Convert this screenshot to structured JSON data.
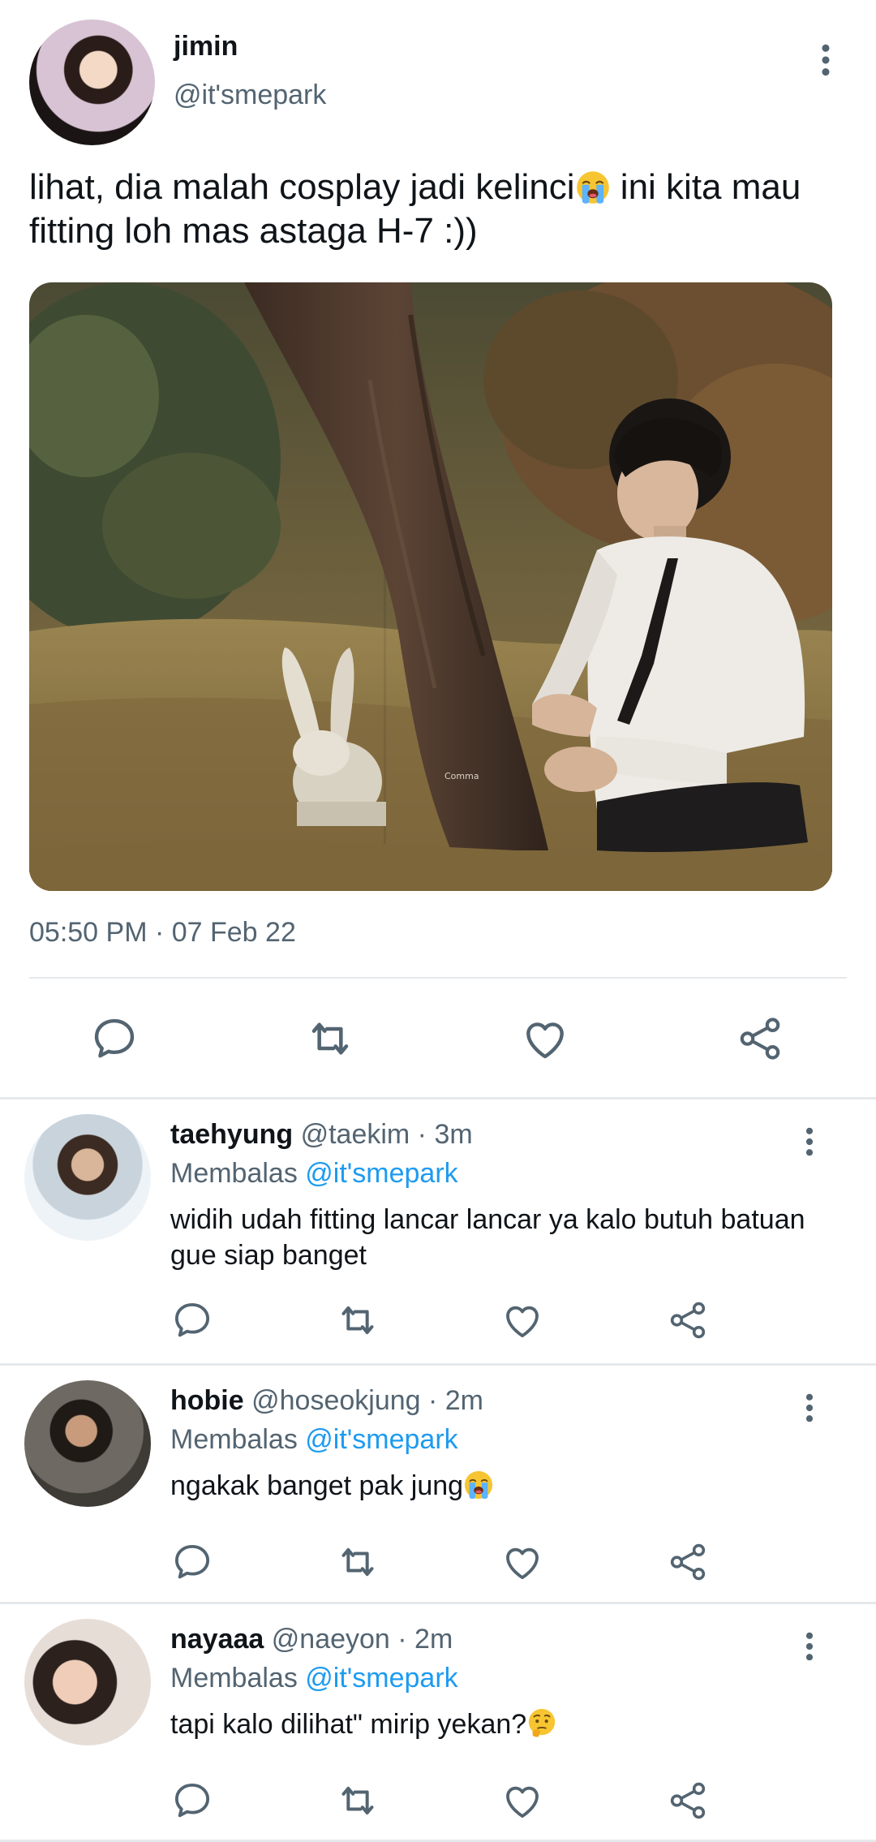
{
  "main_tweet": {
    "author_name": "jimin",
    "author_handle": "@it'smepark",
    "text": "lihat, dia malah cosplay jadi kelinci",
    "text_after_emoji": " ini kita mau fitting loh mas astaga H-7 :))",
    "text_emoji": "loudly-crying-face",
    "image_watermark": "Comma",
    "timestamp": "05:50 PM · 07 Feb 22",
    "actions": [
      "reply",
      "retweet",
      "like",
      "share"
    ]
  },
  "replies": [
    {
      "name": "taehyung",
      "meta": " @taekim · 3m",
      "replying_label": "Membalas ",
      "replying_to": "@it'smepark",
      "text": "widih udah fitting lancar lancar ya kalo butuh batuan gue siap banget"
    },
    {
      "name": "hobie",
      "meta": " @hoseokjung · 2m",
      "replying_label": "Membalas ",
      "replying_to": "@it'smepark",
      "text": "ngakak banget pak jung",
      "emoji": "loudly-crying-face"
    },
    {
      "name": "nayaaa",
      "meta": " @naeyon · 2m",
      "replying_label": "Membalas ",
      "replying_to": "@it'smepark",
      "text": "tapi kalo dilihat\" mirip yekan?",
      "emoji": "thinking-face"
    }
  ],
  "colors": {
    "text": "#0f1419",
    "secondary": "#536471",
    "mention": "#1d9bf0",
    "divider": "#e6e9eb",
    "icon": "#536471"
  }
}
